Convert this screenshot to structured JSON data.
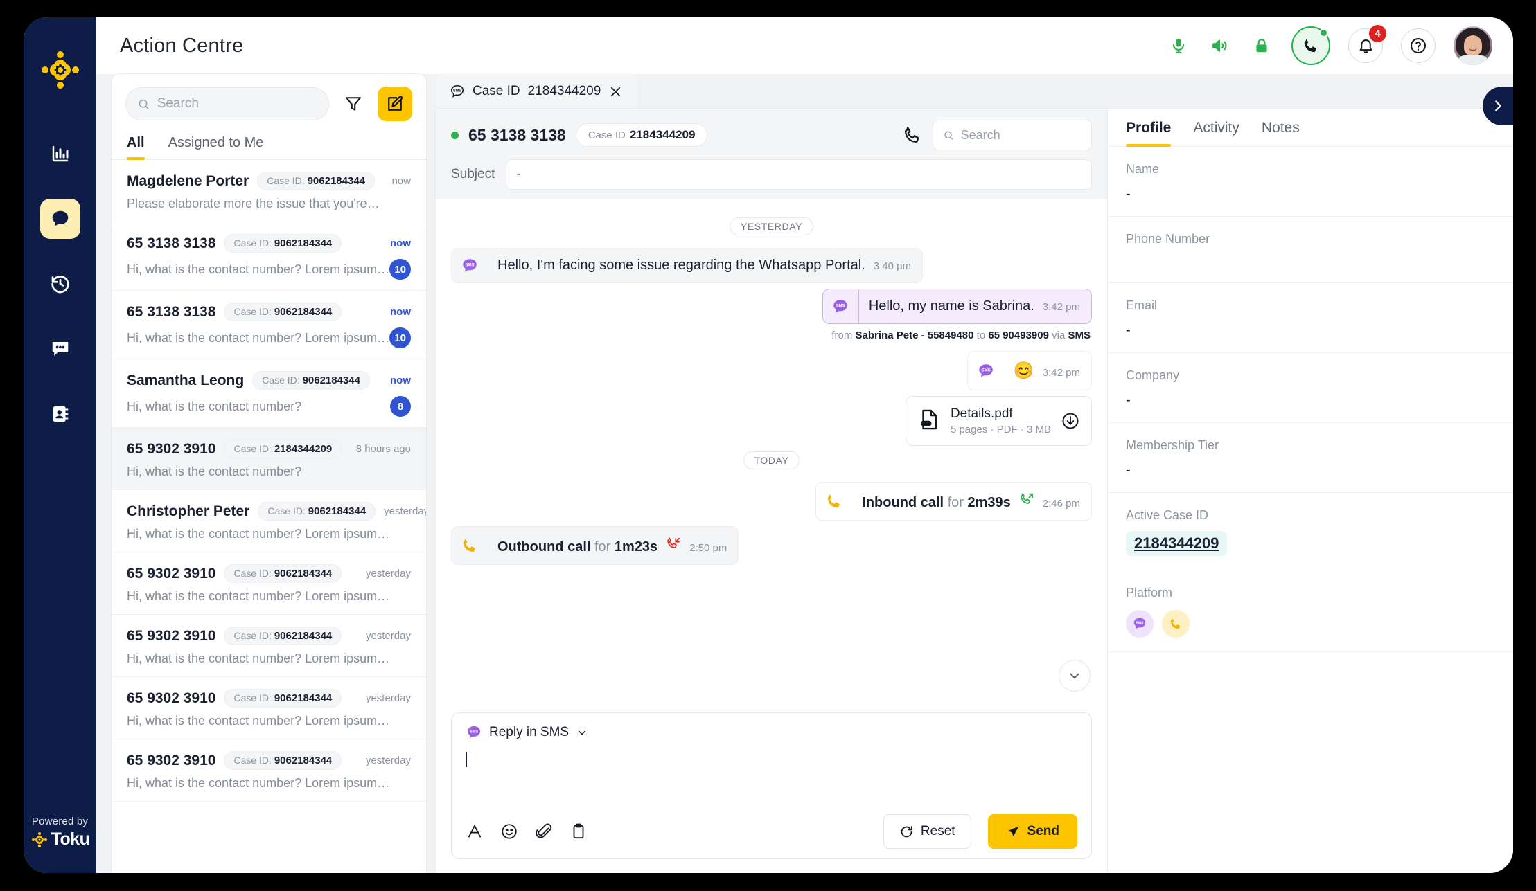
{
  "app": {
    "title": "Action Centre",
    "brand_footer_top": "Powered by",
    "brand_footer_name": "Toku",
    "notification_count": "4",
    "colors": {
      "accent_yellow": "#fdc500",
      "navy": "#0e1d47",
      "blue_badge": "#2f54d4",
      "green_status": "#2bb24c",
      "sms_purple": "#9b5ee8",
      "red_badge": "#e02020"
    }
  },
  "rail": {
    "items": [
      {
        "name": "analytics",
        "icon": "bar-chart-icon",
        "active": false
      },
      {
        "name": "conversations",
        "icon": "chat-bubble-icon",
        "active": true
      },
      {
        "name": "history",
        "icon": "history-clock-icon",
        "active": false
      },
      {
        "name": "messages",
        "icon": "message-dots-icon",
        "active": false
      },
      {
        "name": "contacts",
        "icon": "contacts-book-icon",
        "active": false
      }
    ]
  },
  "topbar": {
    "icons": [
      "microphone-icon",
      "speaker-icon",
      "lock-icon",
      "phone-icon",
      "bell-icon",
      "help-icon"
    ],
    "avatar_alt": "agent-avatar"
  },
  "conversations": {
    "search_placeholder": "Search",
    "search_value": "",
    "filter_icon": "filter-funnel-icon",
    "compose_icon": "compose-pencil-icon",
    "tabs": [
      {
        "label": "All",
        "active": true
      },
      {
        "label": "Assigned to Me",
        "active": false
      }
    ],
    "case_label": "Case ID:",
    "items": [
      {
        "name": "Magdelene Porter",
        "case_id": "9062184344",
        "time": "now",
        "time_highlight": false,
        "preview": "Please elaborate more the issue that you're…",
        "unread": "",
        "selected": false
      },
      {
        "name": "65 3138 3138",
        "case_id": "9062184344",
        "time": "now",
        "time_highlight": true,
        "preview": "Hi, what is the contact number? Lorem ipsum…",
        "unread": "10",
        "selected": false
      },
      {
        "name": "65 3138 3138",
        "case_id": "9062184344",
        "time": "now",
        "time_highlight": true,
        "preview": "Hi, what is the contact number? Lorem ipsum…",
        "unread": "10",
        "selected": false
      },
      {
        "name": "Samantha Leong",
        "case_id": "9062184344",
        "time": "now",
        "time_highlight": true,
        "preview": "Hi, what is the contact number?",
        "unread": "8",
        "selected": false
      },
      {
        "name": "65 9302 3910",
        "case_id": "2184344209",
        "time": "8 hours ago",
        "time_highlight": false,
        "preview": "Hi, what is the contact number?",
        "unread": "",
        "selected": true
      },
      {
        "name": "Christopher Peter",
        "case_id": "9062184344",
        "time": "yesterday",
        "time_highlight": false,
        "preview": "Hi, what is the contact number? Lorem ipsum…",
        "unread": "",
        "selected": false
      },
      {
        "name": "65 9302 3910",
        "case_id": "9062184344",
        "time": "yesterday",
        "time_highlight": false,
        "preview": "Hi, what is the contact number? Lorem ipsum…",
        "unread": "",
        "selected": false
      },
      {
        "name": "65 9302 3910",
        "case_id": "9062184344",
        "time": "yesterday",
        "time_highlight": false,
        "preview": "Hi, what is the contact number? Lorem ipsum…",
        "unread": "",
        "selected": false
      },
      {
        "name": "65 9302 3910",
        "case_id": "9062184344",
        "time": "yesterday",
        "time_highlight": false,
        "preview": "Hi, what is the contact number? Lorem ipsum…",
        "unread": "",
        "selected": false
      },
      {
        "name": "65 9302 3910",
        "case_id": "9062184344",
        "time": "yesterday",
        "time_highlight": false,
        "preview": "Hi, what is the contact number? Lorem ipsum…",
        "unread": "",
        "selected": false
      }
    ]
  },
  "chat": {
    "tab": {
      "channel_icon": "sms-bubble-icon",
      "label": "Case ID",
      "case_id": "2184344209",
      "close_icon": "close-icon"
    },
    "header": {
      "phone": "65 3138 3138",
      "case_label": "Case ID",
      "case_id": "2184344209",
      "call_icon": "phone-outline-icon",
      "search_placeholder": "Search",
      "search_value": "",
      "subject_label": "Subject",
      "subject_value": "-"
    },
    "separators": {
      "yesterday": "YESTERDAY",
      "today": "TODAY"
    },
    "messages": [
      {
        "kind": "text",
        "direction": "in",
        "channel": "sms",
        "text": "Hello, I'm facing some issue regarding the  Whatsapp Portal.",
        "time": "3:40 pm",
        "meta": ""
      },
      {
        "kind": "text",
        "direction": "out",
        "channel": "sms",
        "text": "Hello, my name is Sabrina.",
        "time": "3:42 pm",
        "meta_from_label": "from",
        "meta_from": "Sabrina Pete - 55849480",
        "meta_to_label": "to",
        "meta_to": "65 90493909",
        "meta_via_label": "via",
        "meta_via": "SMS"
      },
      {
        "kind": "emoji",
        "direction": "out",
        "channel": "sms",
        "text": "😊",
        "time": "3:42 pm"
      },
      {
        "kind": "file",
        "direction": "out",
        "file_name": "Details.pdf",
        "file_meta": "5 pages  ·  PDF  ·  3 MB",
        "file_icon": "pdf-file-icon",
        "download_icon": "download-icon"
      },
      {
        "kind": "call",
        "direction": "out",
        "call_type": "Inbound call",
        "for_label": "for",
        "duration": "2m39s",
        "status": "answered",
        "time": "2:46 pm"
      },
      {
        "kind": "call",
        "direction": "in",
        "call_type": "Outbound call",
        "for_label": "for",
        "duration": "1m23s",
        "status": "missed",
        "time": "2:50 pm"
      }
    ],
    "scroll_down_icon": "chevron-down-icon",
    "composer": {
      "reply_as": "Reply in SMS",
      "reply_channel_icon": "sms-bubble-icon",
      "dropdown_icon": "chevron-down-icon",
      "body_value": "",
      "tools": [
        "text-format-icon",
        "emoji-icon",
        "attachment-icon",
        "template-icon"
      ],
      "reset_label": "Reset",
      "reset_icon": "refresh-icon",
      "send_label": "Send",
      "send_icon": "send-plane-icon"
    }
  },
  "profile": {
    "tabs": [
      {
        "label": "Profile",
        "active": true
      },
      {
        "label": "Activity",
        "active": false
      },
      {
        "label": "Notes",
        "active": false
      }
    ],
    "fields": [
      {
        "label": "Name",
        "value": "-",
        "type": "text"
      },
      {
        "label": "Phone Number",
        "value": "",
        "type": "text"
      },
      {
        "label": "Email",
        "value": "-",
        "type": "text"
      },
      {
        "label": "Company",
        "value": "-",
        "type": "text"
      },
      {
        "label": "Membership Tier",
        "value": "-",
        "type": "text"
      },
      {
        "label": "Active Case ID",
        "value": "2184344209",
        "type": "chip"
      },
      {
        "label": "Platform",
        "value": "",
        "type": "platform",
        "platforms": [
          "sms",
          "call"
        ]
      }
    ]
  },
  "expand_panel_icon": "chevron-right-icon"
}
